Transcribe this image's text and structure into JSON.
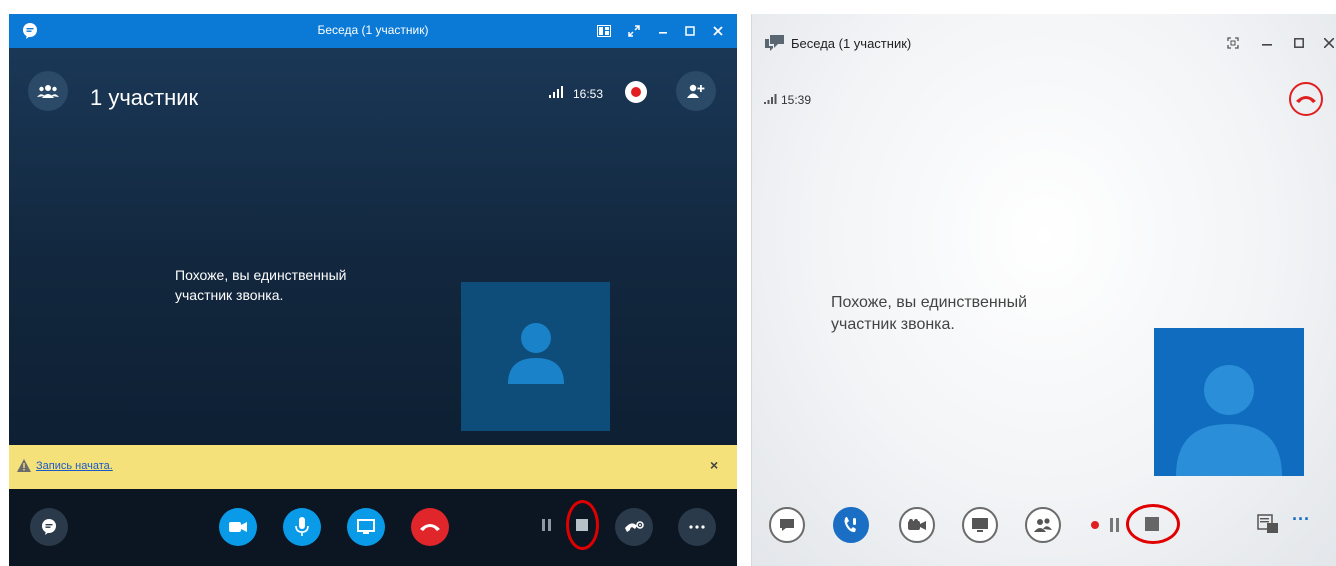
{
  "left_window": {
    "title": "Беседа (1 участник)",
    "participants_label": "1 участник",
    "time": "16:53",
    "alone_message_line1": "Похоже, вы единственный",
    "alone_message_line2": "участник звонка.",
    "banner_text": "Запись начата.",
    "banner_close": "×",
    "colors": {
      "titlebar": "#0a7ad6",
      "accent": "#0a9be8",
      "hangup": "#e0262a",
      "banner": "#f5e17a",
      "record": "#e02020"
    },
    "icons": [
      "skype-chat-icon",
      "people-icon",
      "signal-icon",
      "record-icon",
      "add-person-icon",
      "chat-icon",
      "video-icon",
      "mic-icon",
      "screen-share-icon",
      "hangup-icon",
      "pause-icon",
      "stop-icon",
      "call-settings-icon",
      "more-icon"
    ]
  },
  "right_window": {
    "title": "Беседа (1 участник)",
    "time": "15:39",
    "alone_message_line1": "Похоже, вы единственный",
    "alone_message_line2": "участник звонка.",
    "more_label": "···",
    "colors": {
      "hangup": "#e02020",
      "accent": "#1a6fc4",
      "self_video": "#0f6cbf"
    },
    "icons": [
      "conversation-icon",
      "signal-icon",
      "hangup-icon",
      "chat-icon",
      "call-icon",
      "video-icon",
      "screen-share-icon",
      "participants-icon",
      "record-dot-icon",
      "pause-icon",
      "stop-icon",
      "layout-icon",
      "more-icon"
    ]
  }
}
